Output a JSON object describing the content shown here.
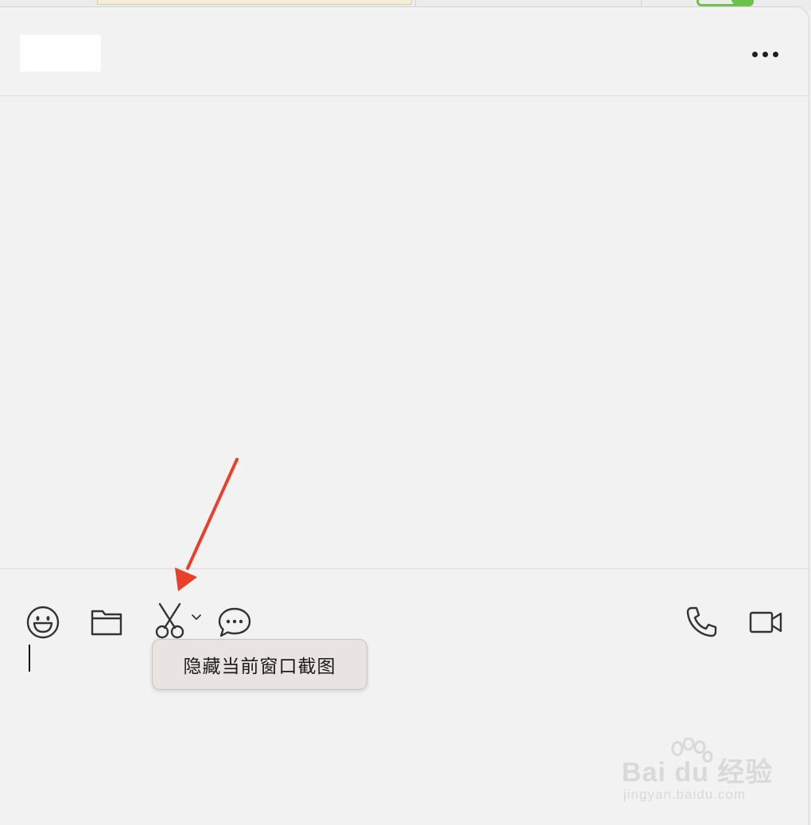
{
  "header": {
    "more_icon": "more-dots-icon"
  },
  "toolbar": {
    "emoji_icon": "emoji-icon",
    "folder_icon": "folder-icon",
    "screenshot_icon": "scissors-icon",
    "screenshot_dropdown_icon": "chevron-down-icon",
    "chat_history_icon": "chat-bubble-icon",
    "voice_call_icon": "phone-icon",
    "video_call_icon": "video-camera-icon"
  },
  "tooltip": {
    "label": "隐藏当前窗口截图"
  },
  "annotation": {
    "arrow_color": "#e8402a"
  },
  "watermark": {
    "main": "Bai du 经验",
    "sub": "jingyan.baidu.com"
  }
}
